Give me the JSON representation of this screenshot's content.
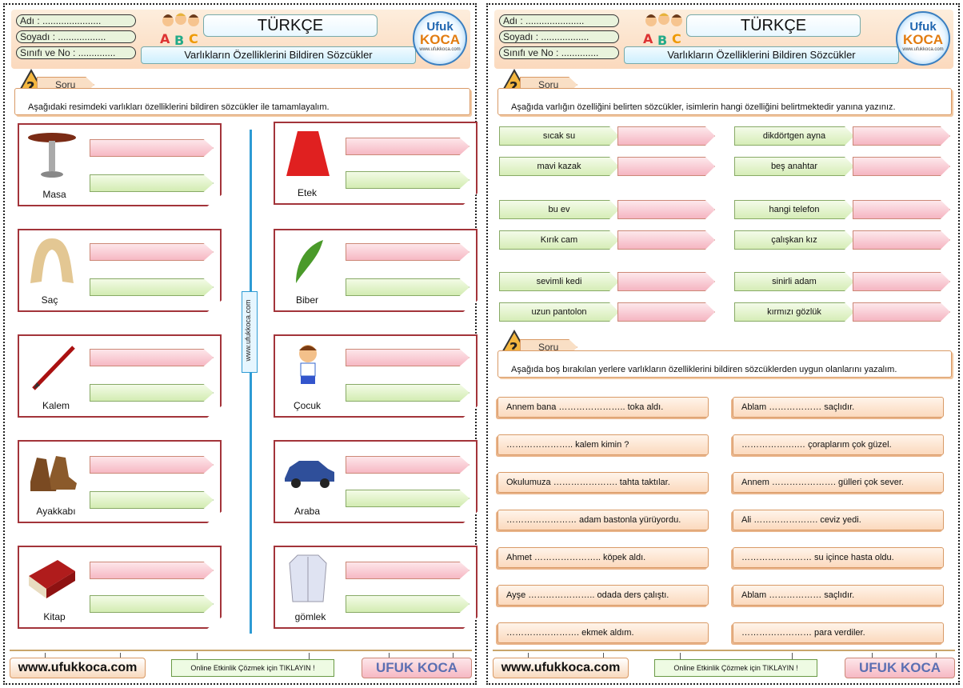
{
  "left": {
    "header": {
      "name_label": "Adı :",
      "surname_label": "Soyadı :",
      "class_label": "Sınıfı ve No :",
      "subject": "TÜRKÇE",
      "topic": "Varlıkların Özelliklerini Bildiren Sözcükler",
      "logo_line1": "Ufuk",
      "logo_line2": "KOCA",
      "logo_url": "www.ufukkoca.com"
    },
    "question": {
      "tag": "Soru",
      "text": "Aşağıdaki resimdeki varlıkları özelliklerini bildiren sözcükler ile tamamlayalım."
    },
    "items": [
      "Masa",
      "Etek",
      "Saç",
      "Biber",
      "Kalem",
      "Çocuk",
      "Ayakkabı",
      "Araba",
      "Kitap",
      "gömlek"
    ],
    "vertical_site": "www.ufukkoca.com",
    "footer": {
      "site": "www.ufukkoca.com",
      "online": "Online Etkinlik Çözmek için TIKLAYIN !",
      "brand": "UFUK KOCA"
    }
  },
  "right": {
    "header": {
      "name_label": "Adı :",
      "surname_label": "Soyadı :",
      "class_label": "Sınıfı ve No :",
      "subject": "TÜRKÇE",
      "topic": "Varlıkların Özelliklerini Bildiren Sözcükler",
      "logo_line1": "Ufuk",
      "logo_line2": "KOCA",
      "logo_url": "www.ufukkoca.com"
    },
    "question1": {
      "tag": "Soru",
      "text": "Aşağıda varlığın özelliğini belirten sözcükler, isimlerin hangi özelliğini belirtmektedir yanına yazınız."
    },
    "phrases": [
      "sıcak su",
      "dikdörtgen ayna",
      "mavi kazak",
      "beş anahtar",
      "bu ev",
      "hangi telefon",
      "Kırık cam",
      "çalışkan kız",
      "sevimli kedi",
      "sinirli adam",
      "uzun pantolon",
      "kırmızı gözlük"
    ],
    "question2": {
      "tag": "Soru",
      "text": "Aşağıda boş bırakılan yerlere varlıkların özelliklerini bildiren sözcüklerden uygun olanlarını yazalım."
    },
    "sentences": [
      "Annem bana ………………….. toka aldı.",
      "Ablam ……………… saçlıdır.",
      "………………….. kalem kimin ?",
      "……………….… çoraplarım çok güzel.",
      "Okulumuza …………………. tahta taktılar.",
      "Annem …………………. gülleri çok sever.",
      "…………………… adam bastonla yürüyordu.",
      "Ali …………………. ceviz yedi.",
      "Ahmet ………………….. köpek aldı.",
      "…………………… su içince hasta oldu.",
      "Ayşe ………………….. odada ders çalıştı.",
      "Ablam ……………… saçlıdır.",
      "……………………. ekmek aldım.",
      "…………………… para verdiler."
    ],
    "footer": {
      "site": "www.ufukkoca.com",
      "online": "Online Etkinlik Çözmek için TIKLAYIN !",
      "brand": "UFUK KOCA"
    }
  }
}
